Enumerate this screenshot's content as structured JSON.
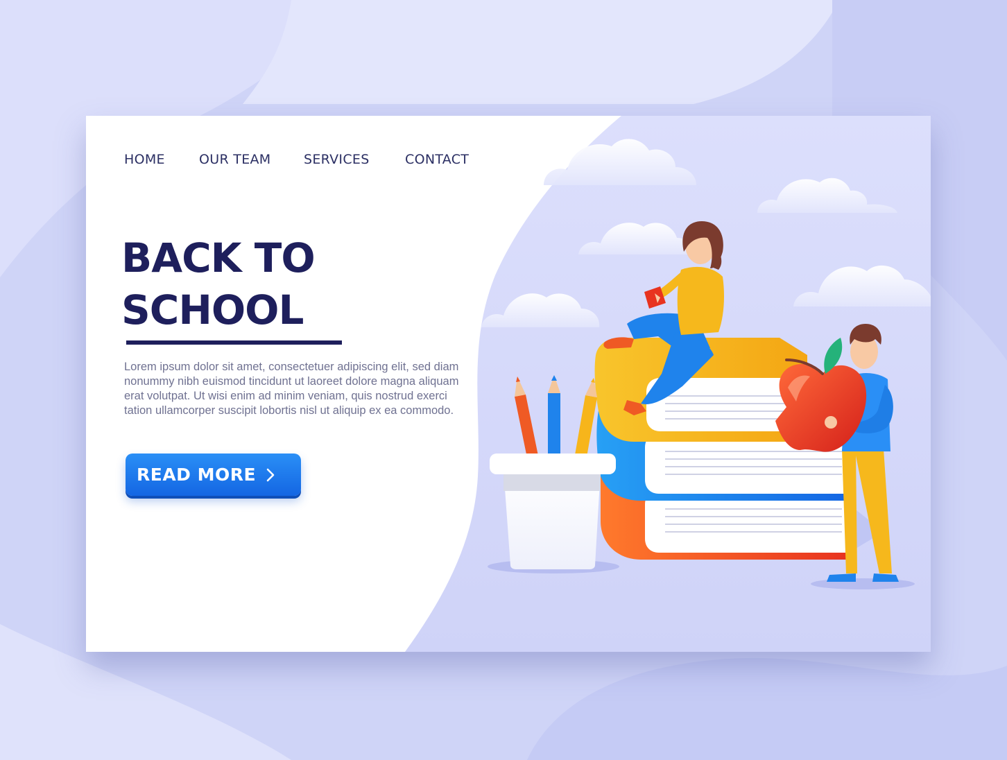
{
  "nav": {
    "items": [
      {
        "label": "HOME"
      },
      {
        "label": "OUR TEAM"
      },
      {
        "label": "SERVICES"
      },
      {
        "label": "CONTACT"
      }
    ]
  },
  "hero": {
    "title_line1": "BACK TO",
    "title_line2": "SCHOOL",
    "body": "Lorem ipsum dolor sit amet, consectetuer adipiscing elit, sed diam nonummy nibh euismod tincidunt ut laoreet dolore magna aliquam erat volutpat. Ut wisi enim ad minim veniam, quis nostrud exerci tation ullamcorper suscipit lobortis nisl ut aliquip ex ea commodo.",
    "button_label": "READ MORE",
    "button_icon": "chevron-right-icon"
  },
  "colors": {
    "page_background": "#cfd4f7",
    "card_background": "#ffffff",
    "hero_panel": "#d3d7fa",
    "title_navy": "#1e1f5c",
    "nav_text": "#2b2f63",
    "body_text": "#6f7191",
    "button_blue": "#1a78ee",
    "book_yellow": "#f6b81c",
    "book_blue": "#1e7fe8",
    "book_red": "#ef4a2a",
    "apple_red": "#e3321f"
  },
  "illustration": {
    "subjects": [
      "girl-reading-icon",
      "boy-holding-apple-icon",
      "book-stack-icon",
      "pencil-cup-icon",
      "cloud-icon"
    ]
  }
}
